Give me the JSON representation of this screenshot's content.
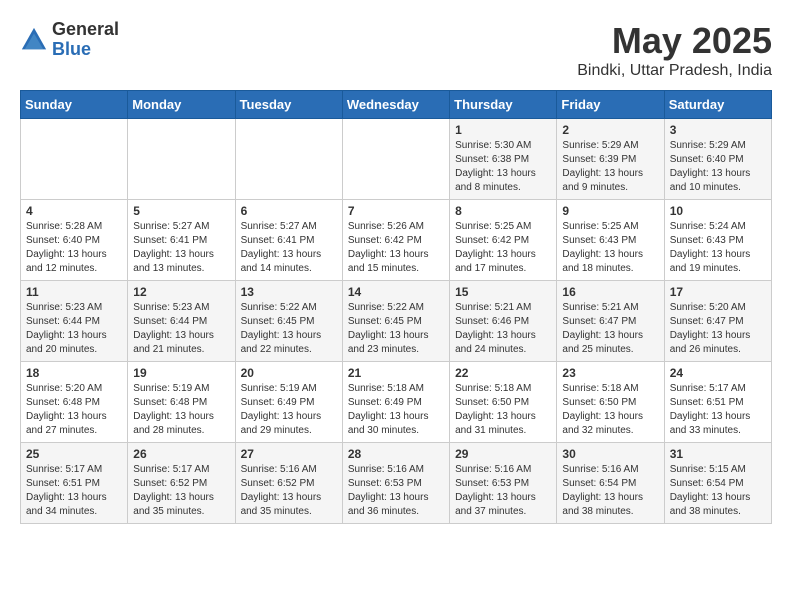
{
  "logo": {
    "general": "General",
    "blue": "Blue"
  },
  "title": "May 2025",
  "subtitle": "Bindki, Uttar Pradesh, India",
  "days_of_week": [
    "Sunday",
    "Monday",
    "Tuesday",
    "Wednesday",
    "Thursday",
    "Friday",
    "Saturday"
  ],
  "weeks": [
    [
      {
        "day": "",
        "info": ""
      },
      {
        "day": "",
        "info": ""
      },
      {
        "day": "",
        "info": ""
      },
      {
        "day": "",
        "info": ""
      },
      {
        "day": "1",
        "info": "Sunrise: 5:30 AM\nSunset: 6:38 PM\nDaylight: 13 hours\nand 8 minutes."
      },
      {
        "day": "2",
        "info": "Sunrise: 5:29 AM\nSunset: 6:39 PM\nDaylight: 13 hours\nand 9 minutes."
      },
      {
        "day": "3",
        "info": "Sunrise: 5:29 AM\nSunset: 6:40 PM\nDaylight: 13 hours\nand 10 minutes."
      }
    ],
    [
      {
        "day": "4",
        "info": "Sunrise: 5:28 AM\nSunset: 6:40 PM\nDaylight: 13 hours\nand 12 minutes."
      },
      {
        "day": "5",
        "info": "Sunrise: 5:27 AM\nSunset: 6:41 PM\nDaylight: 13 hours\nand 13 minutes."
      },
      {
        "day": "6",
        "info": "Sunrise: 5:27 AM\nSunset: 6:41 PM\nDaylight: 13 hours\nand 14 minutes."
      },
      {
        "day": "7",
        "info": "Sunrise: 5:26 AM\nSunset: 6:42 PM\nDaylight: 13 hours\nand 15 minutes."
      },
      {
        "day": "8",
        "info": "Sunrise: 5:25 AM\nSunset: 6:42 PM\nDaylight: 13 hours\nand 17 minutes."
      },
      {
        "day": "9",
        "info": "Sunrise: 5:25 AM\nSunset: 6:43 PM\nDaylight: 13 hours\nand 18 minutes."
      },
      {
        "day": "10",
        "info": "Sunrise: 5:24 AM\nSunset: 6:43 PM\nDaylight: 13 hours\nand 19 minutes."
      }
    ],
    [
      {
        "day": "11",
        "info": "Sunrise: 5:23 AM\nSunset: 6:44 PM\nDaylight: 13 hours\nand 20 minutes."
      },
      {
        "day": "12",
        "info": "Sunrise: 5:23 AM\nSunset: 6:44 PM\nDaylight: 13 hours\nand 21 minutes."
      },
      {
        "day": "13",
        "info": "Sunrise: 5:22 AM\nSunset: 6:45 PM\nDaylight: 13 hours\nand 22 minutes."
      },
      {
        "day": "14",
        "info": "Sunrise: 5:22 AM\nSunset: 6:45 PM\nDaylight: 13 hours\nand 23 minutes."
      },
      {
        "day": "15",
        "info": "Sunrise: 5:21 AM\nSunset: 6:46 PM\nDaylight: 13 hours\nand 24 minutes."
      },
      {
        "day": "16",
        "info": "Sunrise: 5:21 AM\nSunset: 6:47 PM\nDaylight: 13 hours\nand 25 minutes."
      },
      {
        "day": "17",
        "info": "Sunrise: 5:20 AM\nSunset: 6:47 PM\nDaylight: 13 hours\nand 26 minutes."
      }
    ],
    [
      {
        "day": "18",
        "info": "Sunrise: 5:20 AM\nSunset: 6:48 PM\nDaylight: 13 hours\nand 27 minutes."
      },
      {
        "day": "19",
        "info": "Sunrise: 5:19 AM\nSunset: 6:48 PM\nDaylight: 13 hours\nand 28 minutes."
      },
      {
        "day": "20",
        "info": "Sunrise: 5:19 AM\nSunset: 6:49 PM\nDaylight: 13 hours\nand 29 minutes."
      },
      {
        "day": "21",
        "info": "Sunrise: 5:18 AM\nSunset: 6:49 PM\nDaylight: 13 hours\nand 30 minutes."
      },
      {
        "day": "22",
        "info": "Sunrise: 5:18 AM\nSunset: 6:50 PM\nDaylight: 13 hours\nand 31 minutes."
      },
      {
        "day": "23",
        "info": "Sunrise: 5:18 AM\nSunset: 6:50 PM\nDaylight: 13 hours\nand 32 minutes."
      },
      {
        "day": "24",
        "info": "Sunrise: 5:17 AM\nSunset: 6:51 PM\nDaylight: 13 hours\nand 33 minutes."
      }
    ],
    [
      {
        "day": "25",
        "info": "Sunrise: 5:17 AM\nSunset: 6:51 PM\nDaylight: 13 hours\nand 34 minutes."
      },
      {
        "day": "26",
        "info": "Sunrise: 5:17 AM\nSunset: 6:52 PM\nDaylight: 13 hours\nand 35 minutes."
      },
      {
        "day": "27",
        "info": "Sunrise: 5:16 AM\nSunset: 6:52 PM\nDaylight: 13 hours\nand 35 minutes."
      },
      {
        "day": "28",
        "info": "Sunrise: 5:16 AM\nSunset: 6:53 PM\nDaylight: 13 hours\nand 36 minutes."
      },
      {
        "day": "29",
        "info": "Sunrise: 5:16 AM\nSunset: 6:53 PM\nDaylight: 13 hours\nand 37 minutes."
      },
      {
        "day": "30",
        "info": "Sunrise: 5:16 AM\nSunset: 6:54 PM\nDaylight: 13 hours\nand 38 minutes."
      },
      {
        "day": "31",
        "info": "Sunrise: 5:15 AM\nSunset: 6:54 PM\nDaylight: 13 hours\nand 38 minutes."
      }
    ]
  ]
}
